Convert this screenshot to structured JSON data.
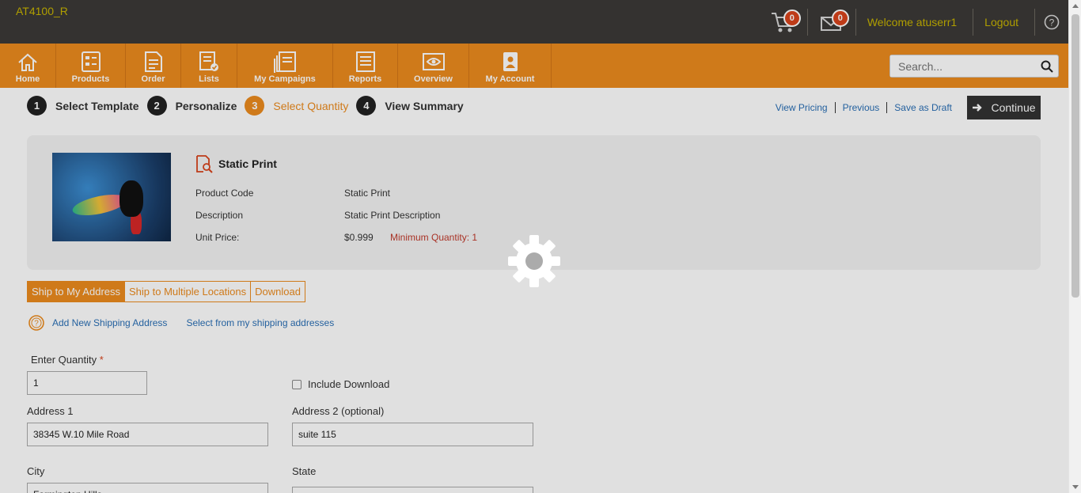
{
  "header": {
    "site_code": "AT4100_R",
    "cart_count": "0",
    "messages_count": "0",
    "welcome": "Welcome atuserr1",
    "logout": "Logout"
  },
  "nav": {
    "items": [
      {
        "label": "Home",
        "icon": "home-icon"
      },
      {
        "label": "Products",
        "icon": "products-icon"
      },
      {
        "label": "Order",
        "icon": "order-icon"
      },
      {
        "label": "Lists",
        "icon": "lists-icon"
      },
      {
        "label": "My Campaigns",
        "icon": "campaigns-icon"
      },
      {
        "label": "Reports",
        "icon": "reports-icon"
      },
      {
        "label": "Overview",
        "icon": "overview-icon"
      },
      {
        "label": "My Account",
        "icon": "account-icon"
      }
    ],
    "search_placeholder": "Search..."
  },
  "steps": [
    {
      "num": "1",
      "label": "Select Template"
    },
    {
      "num": "2",
      "label": "Personalize"
    },
    {
      "num": "3",
      "label": "Select Quantity",
      "active": true
    },
    {
      "num": "4",
      "label": "View Summary"
    }
  ],
  "actions": {
    "view_pricing": "View Pricing",
    "previous": "Previous",
    "save_draft": "Save as Draft",
    "continue": "Continue"
  },
  "product": {
    "title": "Static Print",
    "code_label": "Product Code",
    "code_value": "Static Print",
    "desc_label": "Description",
    "desc_value": "Static Print Description",
    "price_label": "Unit Price:",
    "price_value": "$0.999",
    "min_qty": "Minimum Quantity: 1"
  },
  "shipping": {
    "tabs": [
      "Ship to My Address",
      "Ship to Multiple Locations",
      "Download"
    ],
    "add_new": "Add New Shipping Address",
    "select_from": "Select from my shipping addresses"
  },
  "form": {
    "quantity_label": "Enter Quantity",
    "quantity_required": "*",
    "quantity_value": "1",
    "include_download": "Include Download",
    "address1_label": "Address 1",
    "address1_value": "38345 W.10 Mile Road",
    "address2_label": "Address 2 (optional)",
    "address2_value": "suite 115",
    "city_label": "City",
    "city_value": "Farmington Hills",
    "state_label": "State"
  },
  "colors": {
    "accent": "#ec8b1e",
    "header_bg": "#3c3a37",
    "link": "#2a6fb5",
    "badge": "#d9441c"
  }
}
